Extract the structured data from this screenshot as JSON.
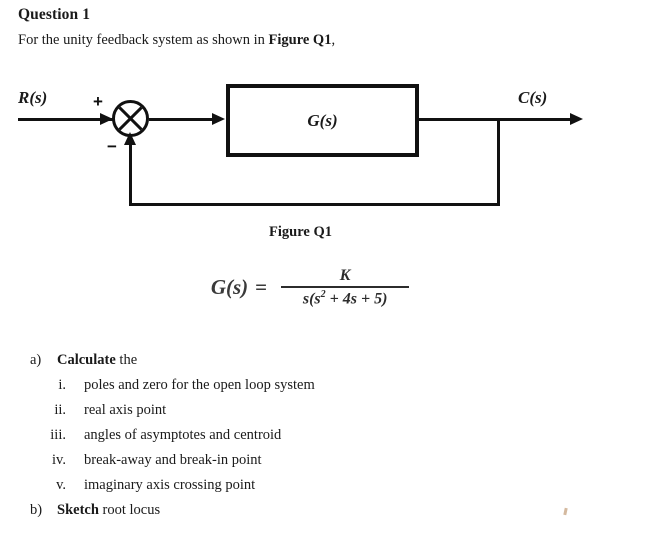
{
  "document": {
    "question_title": "Question 1",
    "intro_prefix": "For the unity feedback system as shown in ",
    "intro_bold": "Figure Q1",
    "intro_suffix": ","
  },
  "diagram": {
    "input_label": "R(s)",
    "output_label": "C(s)",
    "block_label": "G(s)",
    "plus_sign": "+",
    "minus_sign": "−",
    "caption": "Figure Q1"
  },
  "equation": {
    "lhs": "G(s)",
    "equals": "=",
    "numerator": "K",
    "denominator_main": "s(s",
    "denominator_exp": "2",
    "denominator_rest": " + 4s + 5)",
    "plain_text": "G(s) = K / (s(s^2 + 4s + 5))"
  },
  "parts": [
    {
      "letter": "a)",
      "head_bold": "Calculate",
      "head_rest": " the",
      "items": [
        {
          "num": "i.",
          "text": "poles and zero for the open loop system"
        },
        {
          "num": "ii.",
          "text": "real axis point"
        },
        {
          "num": "iii.",
          "text": "angles of asymptotes and centroid"
        },
        {
          "num": "iv.",
          "text": "break-away and break-in point"
        },
        {
          "num": "v.",
          "text": "imaginary axis crossing point"
        }
      ]
    },
    {
      "letter": "b)",
      "head_bold": "Sketch",
      "head_rest": " root locus",
      "items": []
    }
  ],
  "colors": {
    "ink": "#1a1a1a",
    "line": "#111111",
    "equation_ink": "#2c2c2c",
    "page_background": "#ffffff"
  }
}
